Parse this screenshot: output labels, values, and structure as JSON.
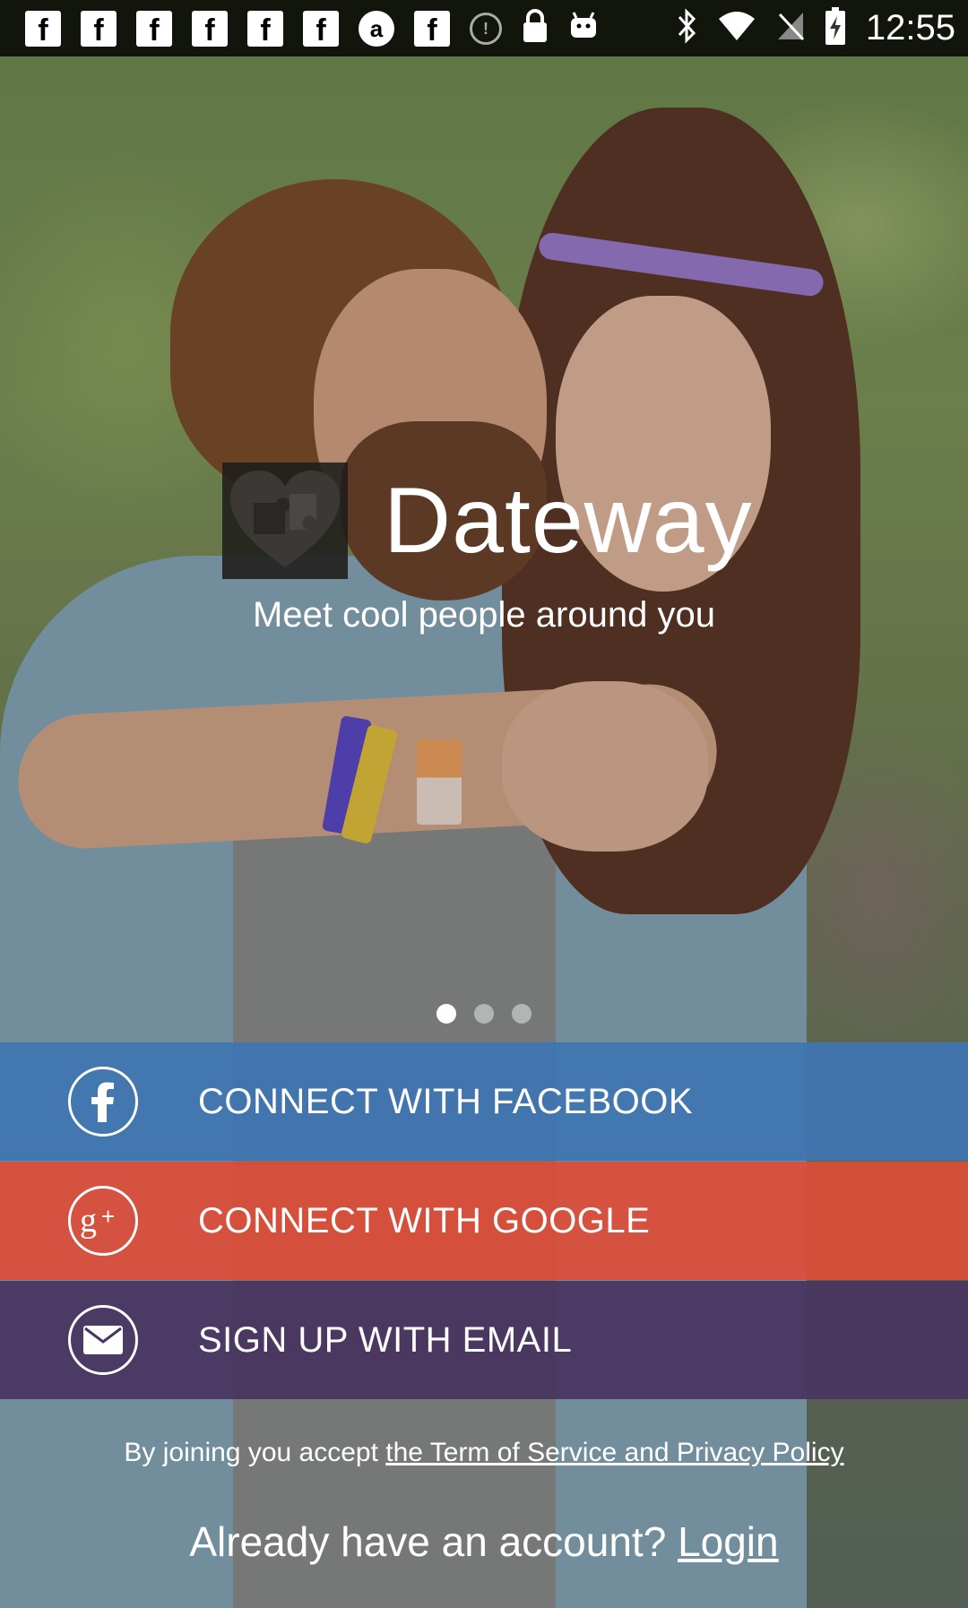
{
  "status_bar": {
    "notifications": [
      "facebook-icon",
      "facebook-icon",
      "facebook-icon",
      "facebook-icon",
      "facebook-icon",
      "facebook-icon",
      "app-a-icon",
      "facebook-icon",
      "info-icon",
      "lock-icon",
      "android-icon"
    ],
    "system_icons": [
      "bluetooth-icon",
      "wifi-icon",
      "no-signal-icon",
      "battery-charging-icon"
    ],
    "time": "12:55"
  },
  "brand": {
    "app_name": "Dateway",
    "tagline": "Meet cool people around you",
    "logo_icon": "puzzle-heart-icon"
  },
  "pager": {
    "count": 3,
    "active_index": 0
  },
  "buttons": {
    "facebook": {
      "label": "CONNECT WITH FACEBOOK",
      "icon": "facebook-icon",
      "color": "#3e75b2"
    },
    "google": {
      "label": "CONNECT WITH GOOGLE",
      "icon": "google-plus-icon",
      "color": "#db4e38"
    },
    "email": {
      "label": "SIGN UP WITH EMAIL",
      "icon": "mail-icon",
      "color": "#483460"
    }
  },
  "footer": {
    "terms_prefix": "By joining you accept ",
    "terms_link": "the Term of Service and Privacy Policy",
    "login_prompt": "Already have an account? ",
    "login_link": "Login"
  }
}
